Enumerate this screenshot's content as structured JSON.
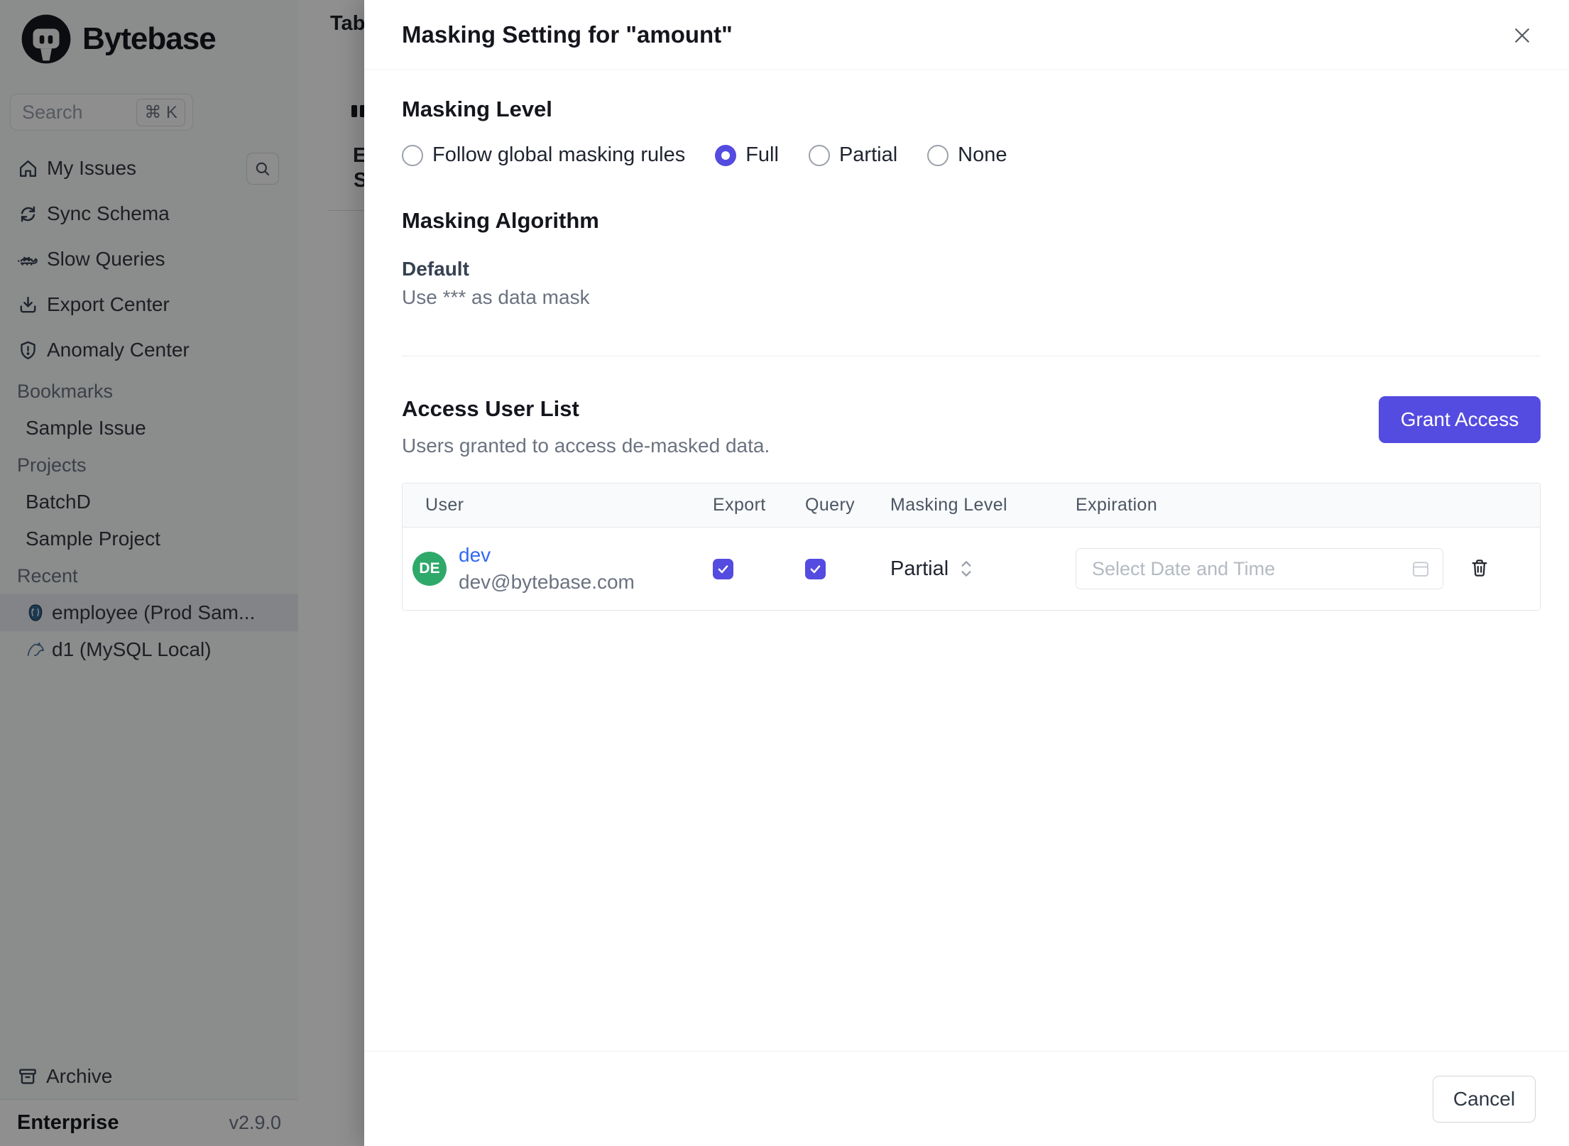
{
  "sidebar": {
    "logo_text": "Bytebase",
    "search": {
      "placeholder": "Search",
      "shortcut": "⌘ K"
    },
    "nav": [
      {
        "label": "My Issues",
        "icon": "home-icon"
      },
      {
        "label": "Sync Schema",
        "icon": "sync-icon"
      },
      {
        "label": "Slow Queries",
        "icon": "turtle-icon"
      },
      {
        "label": "Export Center",
        "icon": "download-icon"
      },
      {
        "label": "Anomaly Center",
        "icon": "shield-icon"
      }
    ],
    "groups": [
      {
        "title": "Bookmarks",
        "items": [
          {
            "label": "Sample Issue"
          }
        ]
      },
      {
        "title": "Projects",
        "items": [
          {
            "label": "BatchD"
          },
          {
            "label": "Sample Project"
          }
        ]
      },
      {
        "title": "Recent",
        "items": [
          {
            "label": "employee (Prod Sam...",
            "icon": "postgres-icon",
            "selected": true
          },
          {
            "label": "d1 (MySQL Local)",
            "icon": "mysql-icon",
            "selected": false
          }
        ]
      }
    ],
    "archive_label": "Archive",
    "plan": "Enterprise",
    "version": "v2.9.0"
  },
  "background_page": {
    "heading_partial": "Tab",
    "label_e": "E",
    "label_s": "S"
  },
  "modal": {
    "title": "Masking Setting for \"amount\"",
    "masking_level": {
      "heading": "Masking Level",
      "options": [
        {
          "label": "Follow global masking rules",
          "selected": false
        },
        {
          "label": "Full",
          "selected": true
        },
        {
          "label": "Partial",
          "selected": false
        },
        {
          "label": "None",
          "selected": false
        }
      ]
    },
    "masking_algorithm": {
      "heading": "Masking Algorithm",
      "name": "Default",
      "description": "Use *** as data mask"
    },
    "access": {
      "heading": "Access User List",
      "subtitle": "Users granted to access de-masked data.",
      "grant_button": "Grant Access"
    },
    "table": {
      "columns": [
        "User",
        "Export",
        "Query",
        "Masking Level",
        "Expiration"
      ],
      "row": {
        "avatar_initials": "DE",
        "name": "dev",
        "email": "dev@bytebase.com",
        "export_checked": true,
        "query_checked": true,
        "masking_level": "Partial",
        "expiration_placeholder": "Select Date and Time"
      }
    },
    "footer": {
      "cancel_label": "Cancel"
    }
  },
  "colors": {
    "accent_indigo": "#544be0",
    "avatar_green": "#2fa96a",
    "link_blue": "#3069f2",
    "sidebar_bg": "#f8f9fa",
    "overlay": "rgba(0,0,0,0.44)"
  }
}
